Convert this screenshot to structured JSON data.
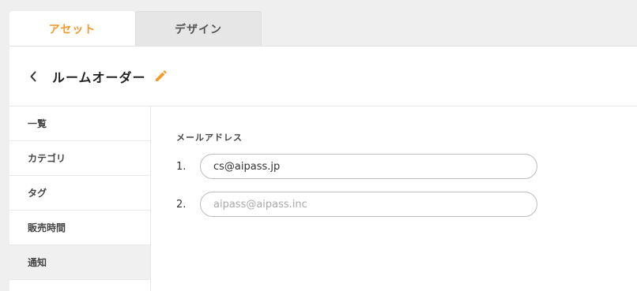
{
  "tabs": [
    {
      "label": "アセット",
      "active": true
    },
    {
      "label": "デザイン",
      "active": false
    }
  ],
  "header": {
    "title": "ルームオーダー",
    "back_icon": "chevron-left-icon",
    "edit_icon": "pencil-icon"
  },
  "sidebar": {
    "items": [
      {
        "label": "一覧"
      },
      {
        "label": "カテゴリ"
      },
      {
        "label": "タグ"
      },
      {
        "label": "販売時間"
      },
      {
        "label": "通知",
        "active": true
      }
    ]
  },
  "main": {
    "section_label": "メールアドレス",
    "emails": [
      {
        "number": "1.",
        "value": "cs@aipass.jp",
        "placeholder": ""
      },
      {
        "number": "2.",
        "value": "",
        "placeholder": "aipass@aipass.inc"
      }
    ]
  },
  "colors": {
    "accent": "#f29a2e",
    "page_bg": "#efefef",
    "active_sidebar_bg": "#f0f0f0"
  }
}
